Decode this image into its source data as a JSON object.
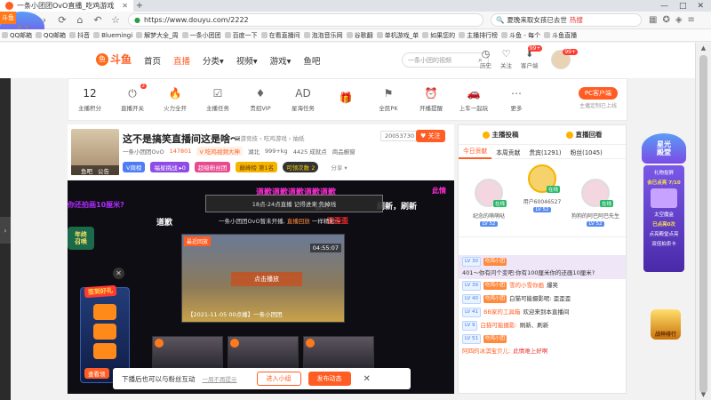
{
  "browser": {
    "tab_title": "一条小团团OvO直播_吃鸡游戏",
    "new_tab": "+",
    "corner_label": "斗鱼",
    "url": "https://www.douyu.com/2222",
    "search_text": "夏晚来取女孩已去世",
    "search_hot": "热搜",
    "window_buttons": [
      "—",
      "□",
      "✕"
    ],
    "bookmarks": [
      "QQ邮箱",
      "QQ邮箱",
      "抖音",
      "Bluemingi",
      "解梦大全_周",
      "一条小团团",
      "百度一下",
      "在看直播间",
      "泡泡音乐网",
      "谷歌翻",
      "单机游戏_单",
      "如果您的",
      "主播排行榜",
      "斗鱼 - 每个",
      "斗鱼直播"
    ]
  },
  "site": {
    "logo_text": "斗鱼",
    "nav": [
      "首页",
      "直播",
      "分类▾",
      "视频▾",
      "游戏▾",
      "鱼吧"
    ],
    "active_nav": "直播",
    "search_placeholder": "一条小团的视频",
    "header_icons": [
      {
        "label": "历史",
        "icon": "clock-icon"
      },
      {
        "label": "关注",
        "icon": "heart-icon"
      },
      {
        "label": "客户端",
        "icon": "download-icon",
        "badge": "99+"
      }
    ],
    "avatar_badge": "99+"
  },
  "tools": {
    "score_value": "12",
    "score_label": "主播积分",
    "items": [
      {
        "label": "直播开关",
        "glyph": "⏻",
        "badge": "2"
      },
      {
        "label": "火力全开",
        "glyph": "🔥"
      },
      {
        "label": "主播任务",
        "glyph": "☑"
      },
      {
        "label": "贵招VIP",
        "glyph": "♦"
      },
      {
        "label": "星海任务",
        "glyph": "AD"
      },
      {
        "label": "",
        "glyph": "🎁"
      },
      {
        "label": "全民PK",
        "glyph": "⚑"
      },
      {
        "label": "开播提醒",
        "glyph": "⏰"
      },
      {
        "label": "上车一起玩",
        "glyph": "🚗"
      },
      {
        "label": "更多",
        "glyph": "⋯"
      }
    ],
    "pc_button": "PC客户端",
    "pc_sub": "主播定制已上线"
  },
  "room": {
    "title": "这不是搞笑直播间这是啥～",
    "tags": "网游竞技 › 吃鸡游戏 › 抽纸",
    "room_id": "20053730",
    "follow_label": "♥ 关注",
    "avatar_caption_1": "鱼吧",
    "avatar_caption_2": "公告",
    "anchor": "一条小团团OvO",
    "heat": "147801",
    "v_tag": "V 吃鸡视频大神",
    "location": "湖北",
    "weight": "999+kg",
    "fans": "4425 成就点",
    "report": "商品橱窗",
    "line3": [
      "V周榜",
      "福星挑战 ▸0",
      "超级粉丝团",
      "巅峰榜 第1名"
    ],
    "countdown": "可领次数 2",
    "share": "分享 ▾"
  },
  "video": {
    "danmaku": [
      {
        "text": "道歉道歉道歉道歉道歉",
        "color": "#ff2bd6"
      },
      {
        "text": "此情",
        "color": "#ff2bd6"
      },
      {
        "text": "你还拍画10厘米?",
        "color": "#b02bff"
      },
      {
        "text": "道歉",
        "color": "#ffffff"
      },
      {
        "text": "猛呢",
        "color": "#ffffff"
      },
      {
        "text": "歪歪歪",
        "color": "#ff2b2b"
      },
      {
        "text": "刷新，刷新",
        "color": "#ffffff"
      }
    ],
    "notice": "18点-24点直播 记得进来 先掉线",
    "subline_a": "一条小团团OvO暂未开播,",
    "subline_b": "直播回放",
    "subline_c": "一样精彩～",
    "player_label": "最近回放",
    "player_time": "04:55:07",
    "player_center": "点击播放",
    "player_caption": "【2021-11-05 00点播】一条小团团",
    "left_badge": "年终\n召唤",
    "activity_title": "签到好礼",
    "activity_footer": "查看领",
    "close": "✕"
  },
  "fanbar": {
    "text": "下播后也可以与粉丝互动",
    "dismiss": "一周不再提示",
    "enter": "进入小组",
    "post": "发布动态",
    "close": "✕"
  },
  "rightpanel": {
    "head_left": "主播投稿",
    "head_right": "直播回看",
    "tabs": [
      "今日贡献",
      "本周贡献",
      "贵宾(1291)",
      "粉丝(1045)"
    ],
    "ranking": [
      {
        "name": "纪念的萌萌哒",
        "lv": "LV 52",
        "online": "在线"
      },
      {
        "name": "用户60046527",
        "lv": "LV 52",
        "online": "在线"
      },
      {
        "name": "狗狗的阿巴阿巴先生",
        "lv": "LV 52",
        "online": "在线"
      }
    ],
    "chat": [
      {
        "lv": "LV 30",
        "fan": "吃鸡小团",
        "name": "",
        "text": "401～你有问个变吧:你有100厘米你的还画10厘米?",
        "hl": true
      },
      {
        "lv": "LV 39",
        "fan": "吃鸡小团",
        "name": "雪的小雪你画",
        "text": "爆笑",
        "hl": false
      },
      {
        "lv": "LV 40",
        "fan": "吃鸡小团",
        "name": "",
        "text": "白猫可能摄影呢: 歪歪歪",
        "hl": false
      },
      {
        "lv": "LV 41",
        "fan": "",
        "name": "BB家的工具箱",
        "text": "欢迎来到本直播间",
        "hl": false
      },
      {
        "lv": "LV 9",
        "fan": "",
        "name": "白猫可能摄影:",
        "text": "刷新、刷新",
        "hl": false
      },
      {
        "lv": "LV 51",
        "fan": "吃鸡小团",
        "name": "",
        "text": "",
        "hl": false
      },
      {
        "lv": "",
        "fan": "",
        "name": "阿四的冰淇宝贝儿:",
        "text": "此情难上好啊",
        "hl": false
      }
    ]
  },
  "sideads": {
    "star_title": "星光\n殿堂",
    "card_lines": [
      "礼物投屏",
      "会已点亮 7/10",
      "太空魔盒",
      "已点亮0次",
      "点亮殿堂点亮",
      "双倍拍卖卡"
    ],
    "jx": "战神排行"
  }
}
